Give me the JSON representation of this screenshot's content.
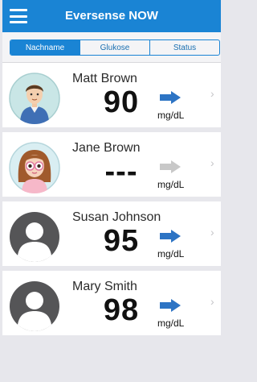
{
  "app": {
    "title": "Eversense NOW"
  },
  "tabs": [
    {
      "label": "Nachname",
      "active": true
    },
    {
      "label": "Glukose",
      "active": false
    },
    {
      "label": "Status",
      "active": false
    }
  ],
  "unit_label": "mg/dL",
  "colors": {
    "brand": "#1a84d4",
    "trend_arrow": "#2d74c4",
    "trend_arrow_inactive": "#c8c8c8"
  },
  "users": [
    {
      "name": "Matt Brown",
      "value": "90",
      "trend": "flat",
      "avatar": "male-cartoon-avatar"
    },
    {
      "name": "Jane Brown",
      "value": "---",
      "trend": "flat-inactive",
      "avatar": "female-cartoon-avatar"
    },
    {
      "name": "Susan Johnson",
      "value": "95",
      "trend": "flat",
      "avatar": "default-user-avatar"
    },
    {
      "name": "Mary Smith",
      "value": "98",
      "trend": "flat",
      "avatar": "default-user-avatar"
    }
  ]
}
